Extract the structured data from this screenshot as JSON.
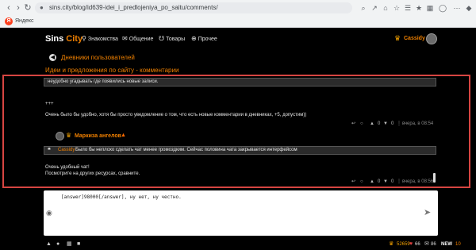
{
  "browser": {
    "url": "sins.city/blog/id639-idei_i_predlojeniya_po_saitu/comments/",
    "bookmark_label": "Яндекс"
  },
  "site": {
    "logo_first": "Sins",
    "logo_second": "City",
    "nav": [
      {
        "label": "Знакомства",
        "icon": "search-icon"
      },
      {
        "label": "Общение",
        "icon": "chat-icon"
      },
      {
        "label": "Товары",
        "icon": "cart-icon"
      },
      {
        "label": "Прочее",
        "icon": "more-icon"
      }
    ],
    "user_name": "Cassidy"
  },
  "breadcrumb": "Дневники пользователей",
  "page_title": "Идеи и предложения по сайту - комментарии",
  "comments": [
    {
      "quote": "неудобно угадывать где появились новые записи.",
      "body": [
        "+++",
        "Очень было бы удобно, хотя бы просто уведомление о том, что есть новые комментарии в дневниках, +5, допустим))"
      ],
      "likes": "0",
      "dislikes": "0",
      "time": "вчера, в 08:54"
    },
    {
      "author": "Маркиза ангелов",
      "quote_author": "Cassidy :",
      "quote": "Было бы неплохо сделать чат менее громоздким. Сейчас половина чата закрывается интерфейсом",
      "body": [
        "Очень удобный чат!",
        "Посмотрите на других ресурсах, сравните."
      ],
      "likes": "0",
      "dislikes": "0",
      "time": "вчера, в 08:56"
    }
  ],
  "composer": {
    "text": "[answer]98000[/answer], ну нет, ну честно."
  },
  "status_bar": {
    "coins": "52659",
    "hearts": "66",
    "messages": "86",
    "new_label": "NEW",
    "new_count": "10"
  },
  "colors": {
    "accent": "#f08000",
    "highlight_frame": "#d64541",
    "background": "#000000"
  }
}
